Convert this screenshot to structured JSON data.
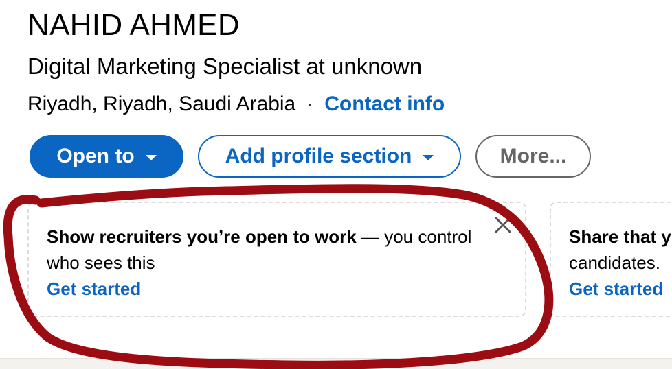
{
  "profile": {
    "name": "NAHID AHMED",
    "headline": "Digital Marketing Specialist at unknown",
    "location": "Riyadh, Riyadh, Saudi Arabia",
    "separator": "·",
    "contact_info_label": "Contact info"
  },
  "actions": {
    "open_to_label": "Open to",
    "add_profile_section_label": "Add profile section",
    "more_label": "More..."
  },
  "cards": [
    {
      "title_bold": "Show recruiters you’re open to work",
      "title_rest": " — you control who sees this",
      "cta": "Get started"
    },
    {
      "title_bold": "Share that y",
      "title_rest": "candidates.",
      "cta": "Get started"
    }
  ],
  "icons": {
    "dismiss": "close-icon",
    "dropdown": "caret-down-icon"
  },
  "colors": {
    "brand_blue": "#0a66c2",
    "muted_gray": "#666666",
    "annotation_red": "#9b0d12"
  }
}
